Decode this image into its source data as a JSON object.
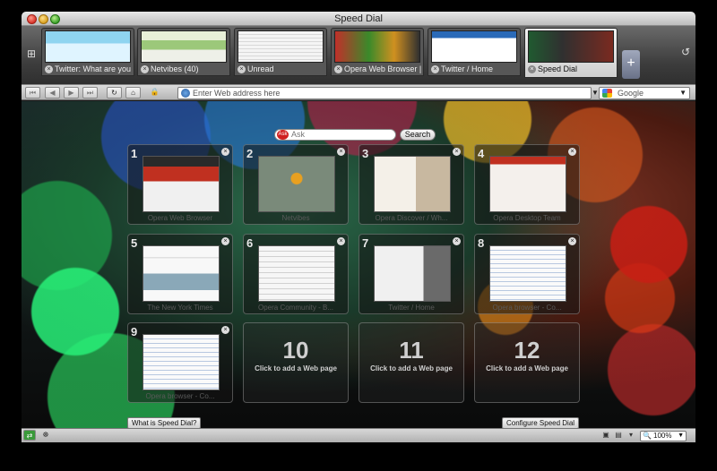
{
  "window": {
    "title": "Speed Dial"
  },
  "tabs": [
    {
      "label": "Twitter: What are you do..."
    },
    {
      "label": "Netvibes (40)"
    },
    {
      "label": "Unread"
    },
    {
      "label": "Opera Web Browser | Fa..."
    },
    {
      "label": "Twitter / Home"
    },
    {
      "label": "Speed Dial"
    }
  ],
  "new_tab_label": "+",
  "address": {
    "placeholder": "Enter Web address here"
  },
  "search_engine": {
    "label": "Google"
  },
  "ask": {
    "placeholder": "Ask",
    "logo": "Ask",
    "button": "Search"
  },
  "dials": [
    {
      "num": "1",
      "label": "Opera Web Browser"
    },
    {
      "num": "2",
      "label": "Netvibes"
    },
    {
      "num": "3",
      "label": "Opera Discover / Wh..."
    },
    {
      "num": "4",
      "label": "Opera Desktop Team"
    },
    {
      "num": "5",
      "label": "The New York Times"
    },
    {
      "num": "6",
      "label": "Opera Community - B..."
    },
    {
      "num": "7",
      "label": "Twitter / Home"
    },
    {
      "num": "8",
      "label": "Opera browser - Co..."
    },
    {
      "num": "9",
      "label": "Opera browser - Co..."
    },
    {
      "num": "10",
      "label": "Click to add a Web page"
    },
    {
      "num": "11",
      "label": "Click to add a Web page"
    },
    {
      "num": "12",
      "label": "Click to add a Web page"
    }
  ],
  "buttons": {
    "what_is": "What is Speed Dial?",
    "configure": "Configure Speed Dial"
  },
  "status": {
    "zoom": "100%"
  }
}
